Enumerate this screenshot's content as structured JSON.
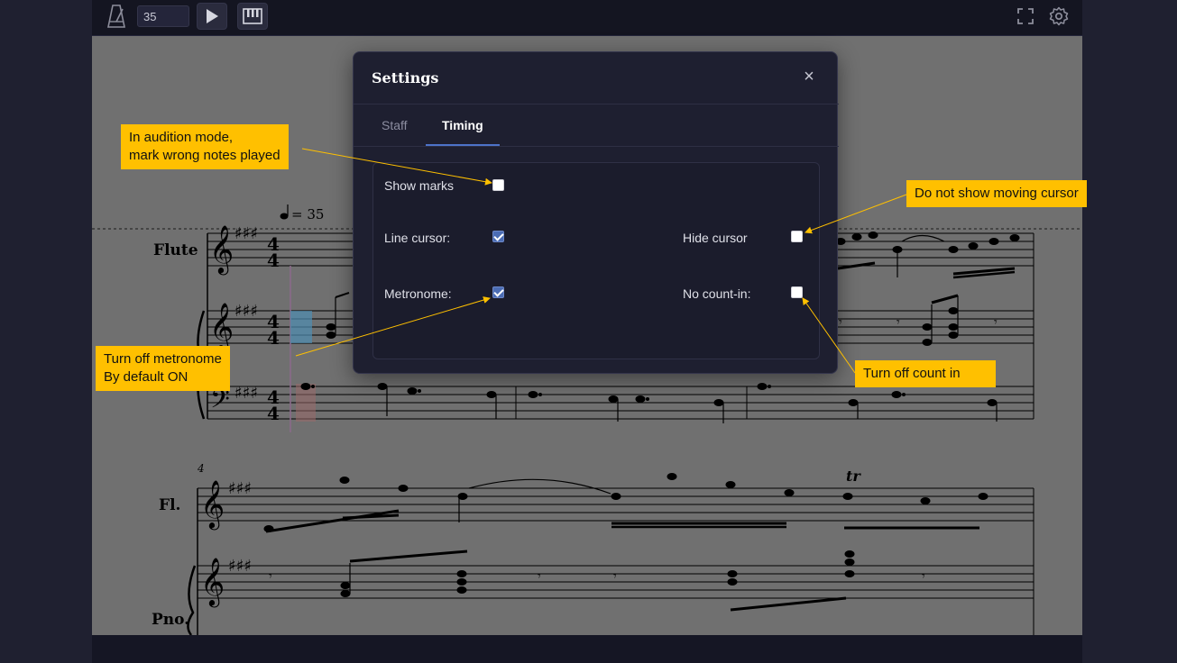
{
  "toolbar": {
    "tempo_value": "35",
    "icons": [
      "metronome-icon",
      "play-icon",
      "piano-keyboard-icon",
      "fullscreen-icon",
      "gear-icon"
    ]
  },
  "score": {
    "tempo_marking": "= 35",
    "instruments": [
      "Flute",
      "Fl.",
      "Pno."
    ],
    "measure_number": "4",
    "trill": "tr"
  },
  "settings": {
    "title": "Settings",
    "close": "×",
    "tabs": [
      {
        "label": "Staff",
        "active": false
      },
      {
        "label": "Timing",
        "active": true
      }
    ],
    "options": {
      "show_marks": {
        "label": "Show marks",
        "checked": false
      },
      "line_cursor": {
        "label": "Line cursor:",
        "checked": true
      },
      "metronome": {
        "label": "Metronome:",
        "checked": true
      },
      "hide_cursor": {
        "label": "Hide cursor",
        "checked": false
      },
      "no_count_in": {
        "label": "No count-in:",
        "checked": false
      }
    }
  },
  "annotations": {
    "audition": [
      "In audition mode,",
      "mark wrong notes played"
    ],
    "metronome": [
      "Turn off metronome",
      "By default ON"
    ],
    "cursor": "Do not show moving cursor",
    "count_in": "Turn off count in"
  },
  "colors": {
    "callout": "#ffc000",
    "accent": "#4b6cb4",
    "score_bg": "#707070"
  }
}
